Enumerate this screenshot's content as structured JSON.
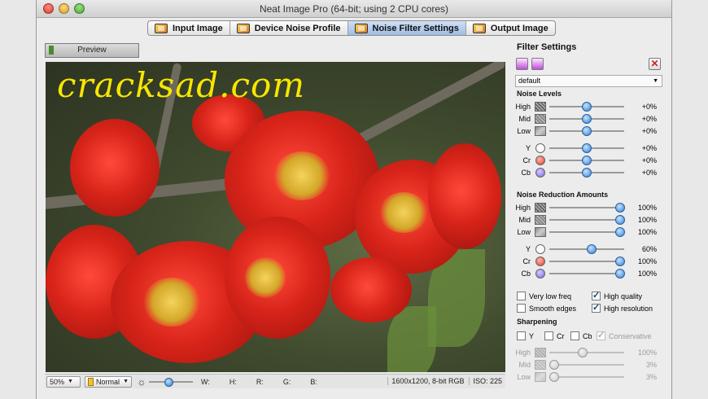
{
  "window": {
    "title": "Neat Image Pro (64-bit; using 2 CPU cores)"
  },
  "tabs": [
    {
      "label": "Input Image",
      "active": false
    },
    {
      "label": "Device Noise Profile",
      "active": false
    },
    {
      "label": "Noise Filter Settings",
      "active": true
    },
    {
      "label": "Output Image",
      "active": false
    }
  ],
  "preview": {
    "label": "Preview",
    "watermark": "cracksad.com"
  },
  "status": {
    "zoom": "50%",
    "mode": "Normal",
    "w_label": "W:",
    "h_label": "H:",
    "r_label": "R:",
    "g_label": "G:",
    "b_label": "B:",
    "image_info": "1600x1200, 8-bit RGB",
    "iso": "ISO: 225",
    "brightness_level": 0.45
  },
  "panel": {
    "title": "Filter Settings",
    "preset": "default",
    "noise_levels": {
      "title": "Noise Levels",
      "rows": [
        {
          "label": "High",
          "icon": "noise-high-icon",
          "value": "+0%",
          "level": 0.5
        },
        {
          "label": "Mid",
          "icon": "noise-mid-icon",
          "value": "+0%",
          "level": 0.5
        },
        {
          "label": "Low",
          "icon": "noise-low-icon",
          "value": "+0%",
          "level": 0.5
        },
        {
          "label": "Y",
          "icon": "y-channel-icon",
          "value": "+0%",
          "level": 0.5
        },
        {
          "label": "Cr",
          "icon": "cr-channel-icon",
          "value": "+0%",
          "level": 0.5
        },
        {
          "label": "Cb",
          "icon": "cb-channel-icon",
          "value": "+0%",
          "level": 0.5
        }
      ]
    },
    "reduction": {
      "title": "Noise Reduction Amounts",
      "rows": [
        {
          "label": "High",
          "icon": "noise-high-icon",
          "value": "100%",
          "level": 0.95
        },
        {
          "label": "Mid",
          "icon": "noise-mid-icon",
          "value": "100%",
          "level": 0.95
        },
        {
          "label": "Low",
          "icon": "noise-low-icon",
          "value": "100%",
          "level": 0.95
        },
        {
          "label": "Y",
          "icon": "y-channel-icon",
          "value": "60%",
          "level": 0.57
        },
        {
          "label": "Cr",
          "icon": "cr-channel-icon",
          "value": "100%",
          "level": 0.95
        },
        {
          "label": "Cb",
          "icon": "cb-channel-icon",
          "value": "100%",
          "level": 0.95
        }
      ]
    },
    "options": {
      "very_low_freq": {
        "label": "Very low freq",
        "checked": false
      },
      "high_quality": {
        "label": "High quality",
        "checked": true
      },
      "smooth_edges": {
        "label": "Smooth edges",
        "checked": false
      },
      "high_resolution": {
        "label": "High resolution",
        "checked": true
      }
    },
    "sharpening": {
      "title": "Sharpening",
      "y": {
        "label": "Y",
        "checked": false
      },
      "cr": {
        "label": "Cr",
        "checked": false
      },
      "cb": {
        "label": "Cb",
        "checked": false
      },
      "conservative": {
        "label": "Conservative",
        "checked": true
      },
      "rows": [
        {
          "label": "High",
          "value": "100%",
          "level": 0.45
        },
        {
          "label": "Mid",
          "value": "3%",
          "level": 0.06
        },
        {
          "label": "Low",
          "value": "3%",
          "level": 0.06
        }
      ]
    }
  }
}
